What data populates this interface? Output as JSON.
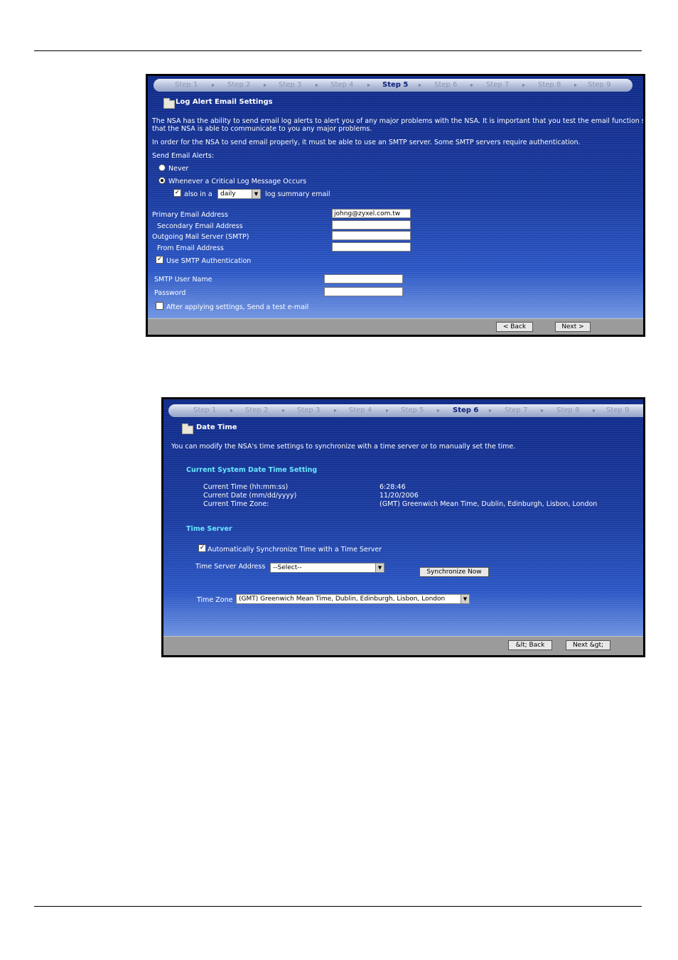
{
  "log_alert": {
    "steps": [
      "Step 1",
      "Step 2",
      "Step 3",
      "Step 4",
      "Step 5",
      "Step 6",
      "Step 7",
      "Step 8",
      "Step 9"
    ],
    "title": "Log Alert Email Settings",
    "intro_1a": "The NSA has the ability to send email log alerts to alert you of any major problems with the NSA. It is important that you test the email function so",
    "intro_1b": "that the NSA is able to communicate to you any major problems.",
    "intro_2": "In order for the NSA to send email properly, it must be able to use an SMTP server. Some SMTP servers require authentication.",
    "send_alerts_label": "Send Email Alerts:",
    "never_label": "Never",
    "whenever_label": "Whenever a Critical Log Message Occurs",
    "also_in_a": "also in a",
    "summary_select": "daily",
    "summary_suffix": "log summary email",
    "primary_label": "Primary Email Address",
    "primary_value": "johng@zyxel.com.tw",
    "secondary_label": "Secondary Email Address",
    "smtp_label": "Outgoing Mail Server (SMTP)",
    "from_label": "From Email Address",
    "use_smtp_auth": "Use SMTP Authentication",
    "smtp_user_label": "SMTP User Name",
    "password_label": "Password",
    "test_email_label": "After applying settings, Send a test e-mail",
    "back_button": "< Back",
    "next_button": "Next >"
  },
  "date_time": {
    "steps": [
      "Step 1",
      "Step 2",
      "Step 3",
      "Step 4",
      "Step 5",
      "Step 6",
      "Step 7",
      "Step 8",
      "Step 9"
    ],
    "title": "Date Time",
    "intro": "You can modify the NSA's time settings to synchronize with a time server or to manually set the time.",
    "current_heading": "Current System Date Time Setting",
    "time_label": "Current Time (hh:mm:ss)",
    "time_value": "6:28:46",
    "date_label": "Current Date (mm/dd/yyyy)",
    "date_value": "11/20/2006",
    "zone_label": "Current Time Zone:",
    "zone_value": "(GMT) Greenwich Mean Time, Dublin, Edinburgh, Lisbon, London",
    "server_heading": "Time Server",
    "auto_sync_label": "Automatically Synchronize Time with a Time Server",
    "server_address_label": "Time Server Address",
    "server_select": "--Select--",
    "sync_button": "Synchronize Now",
    "tz_label": "Time Zone",
    "tz_select": "(GMT) Greenwich Mean Time, Dublin, Edinburgh, Lisbon, London",
    "back_button": "&lt; Back",
    "next_button": "Next &gt;"
  },
  "colors": {
    "panel_blue": "#1a3a9e",
    "heading_cyan": "#69e6ff",
    "footer_gray": "#9b9b9b"
  }
}
